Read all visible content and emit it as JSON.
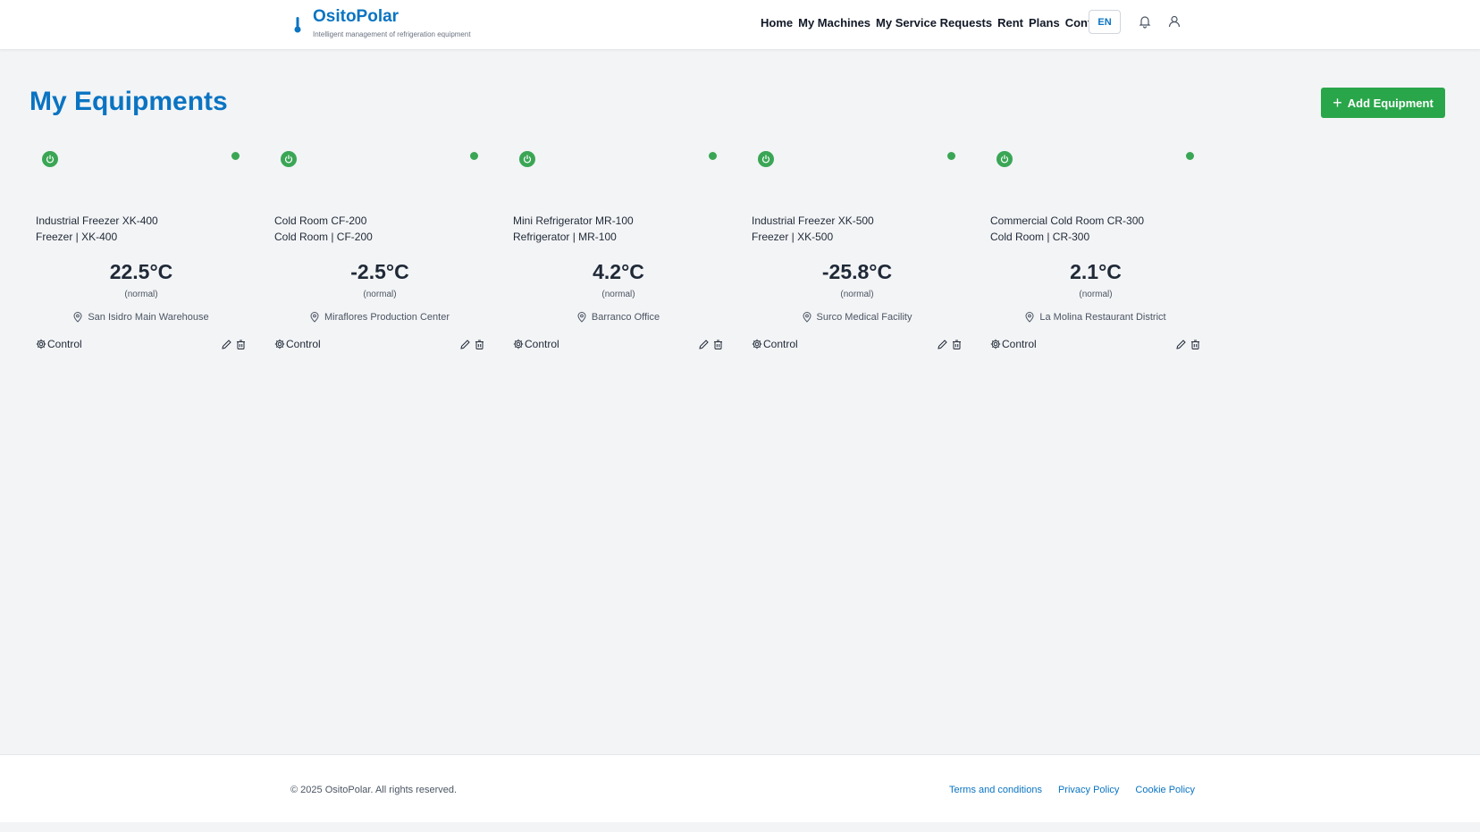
{
  "brand": {
    "name": "OsitoPolar",
    "tagline": "Intelligent management of refrigeration equipment",
    "accent_color": "#0a74c2",
    "icon": "thermometer-icon"
  },
  "nav": {
    "items": [
      "Home",
      "My Machines",
      "My Service Requests",
      "Rent",
      "Plans",
      "Contact"
    ],
    "language": "EN"
  },
  "main": {
    "title": "My Equipments",
    "add_button": "Add Equipment",
    "add_button_color": "#2aa64a"
  },
  "equipments": [
    {
      "name": "Industrial Freezer XK-400",
      "type_model": "Freezer | XK-400",
      "temperature": "22.5°C",
      "status": "(normal)",
      "location": "San Isidro Main Warehouse",
      "control_label": "Control"
    },
    {
      "name": "Cold Room CF-200",
      "type_model": "Cold Room | CF-200",
      "temperature": "-2.5°C",
      "status": "(normal)",
      "location": "Miraflores Production Center",
      "control_label": "Control"
    },
    {
      "name": "Mini Refrigerator MR-100",
      "type_model": "Refrigerator | MR-100",
      "temperature": "4.2°C",
      "status": "(normal)",
      "location": "Barranco Office",
      "control_label": "Control"
    },
    {
      "name": "Industrial Freezer XK-500",
      "type_model": "Freezer | XK-500",
      "temperature": "-25.8°C",
      "status": "(normal)",
      "location": "Surco Medical Facility",
      "control_label": "Control"
    },
    {
      "name": "Commercial Cold Room CR-300",
      "type_model": "Cold Room | CR-300",
      "temperature": "2.1°C",
      "status": "(normal)",
      "location": "La Molina Restaurant District",
      "control_label": "Control"
    }
  ],
  "status_color": "#3aa655",
  "footer": {
    "copyright": "© 2025 OsitoPolar. All rights reserved.",
    "links": [
      "Terms and conditions",
      "Privacy Policy",
      "Cookie Policy"
    ]
  }
}
